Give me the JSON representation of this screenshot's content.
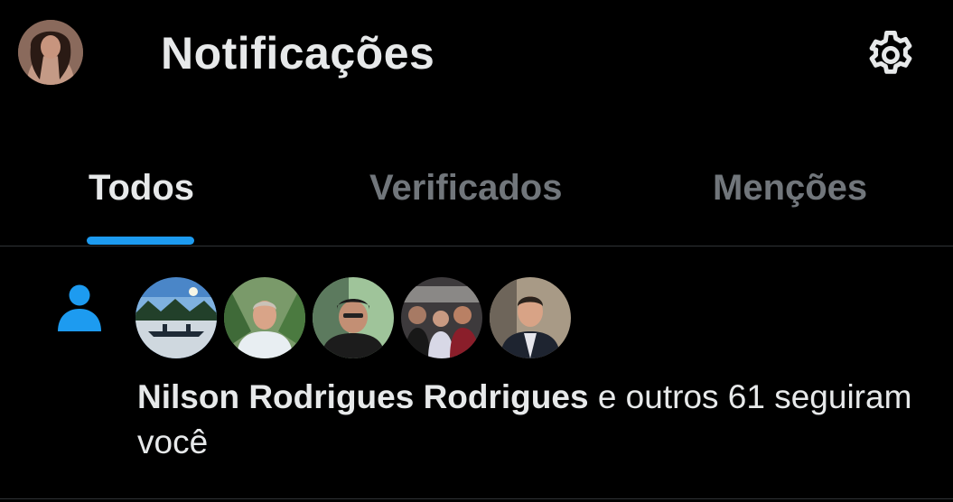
{
  "header": {
    "title": "Notificações",
    "avatar_icon": "profile-avatar",
    "settings_icon": "gear-icon"
  },
  "tabs": [
    {
      "label": "Todos",
      "active": true
    },
    {
      "label": "Verificados",
      "active": false
    },
    {
      "label": "Menções",
      "active": false
    }
  ],
  "notification": {
    "type_icon": "person-follow-icon",
    "follower_avatars": [
      "lake-canoe-avatar",
      "man-smiling-avatar",
      "man-with-cap-avatar",
      "group-selfie-avatar",
      "man-in-suit-avatar"
    ],
    "name": "Nilson Rodrigues Rodrigues",
    "rest": " e outros 61 seguiram você"
  },
  "colors": {
    "background": "#000000",
    "text": "#e7e9ea",
    "muted": "#71767b",
    "accent": "#1d9bf0",
    "divider": "#2f3336"
  }
}
